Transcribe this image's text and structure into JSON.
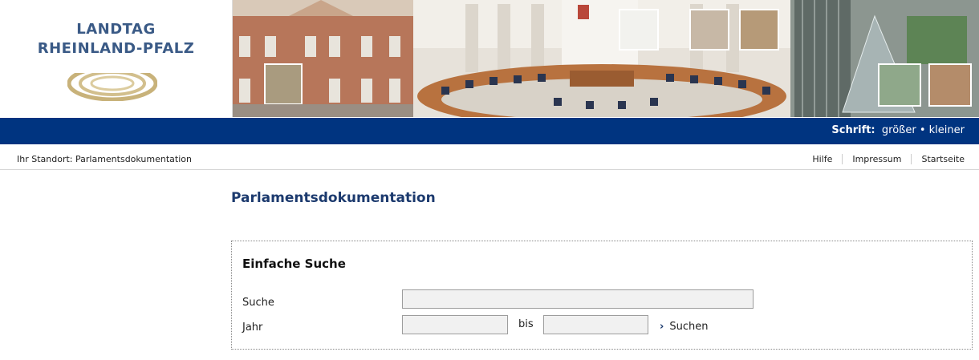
{
  "logo": {
    "line1": "LANDTAG",
    "line2": "RHEINLAND-PFALZ"
  },
  "font_control": {
    "label": "Schrift:",
    "larger": "größer",
    "separator": "•",
    "smaller": "kleiner"
  },
  "breadcrumb": {
    "text": "Ihr Standort: Parlamentsdokumentation"
  },
  "meta_links": [
    "Hilfe",
    "Impressum",
    "Startseite"
  ],
  "page_title": "Parlamentsdokumentation",
  "search": {
    "title": "Einfache Suche",
    "suche_label": "Suche",
    "suche_value": "",
    "jahr_label": "Jahr",
    "jahr_from_value": "",
    "bis_label": "bis",
    "jahr_to_value": "",
    "submit_label": "Suchen"
  },
  "colors": {
    "brand_blue": "#003480",
    "title_blue": "#1c3a6e",
    "logo_blue": "#3a5a86"
  }
}
